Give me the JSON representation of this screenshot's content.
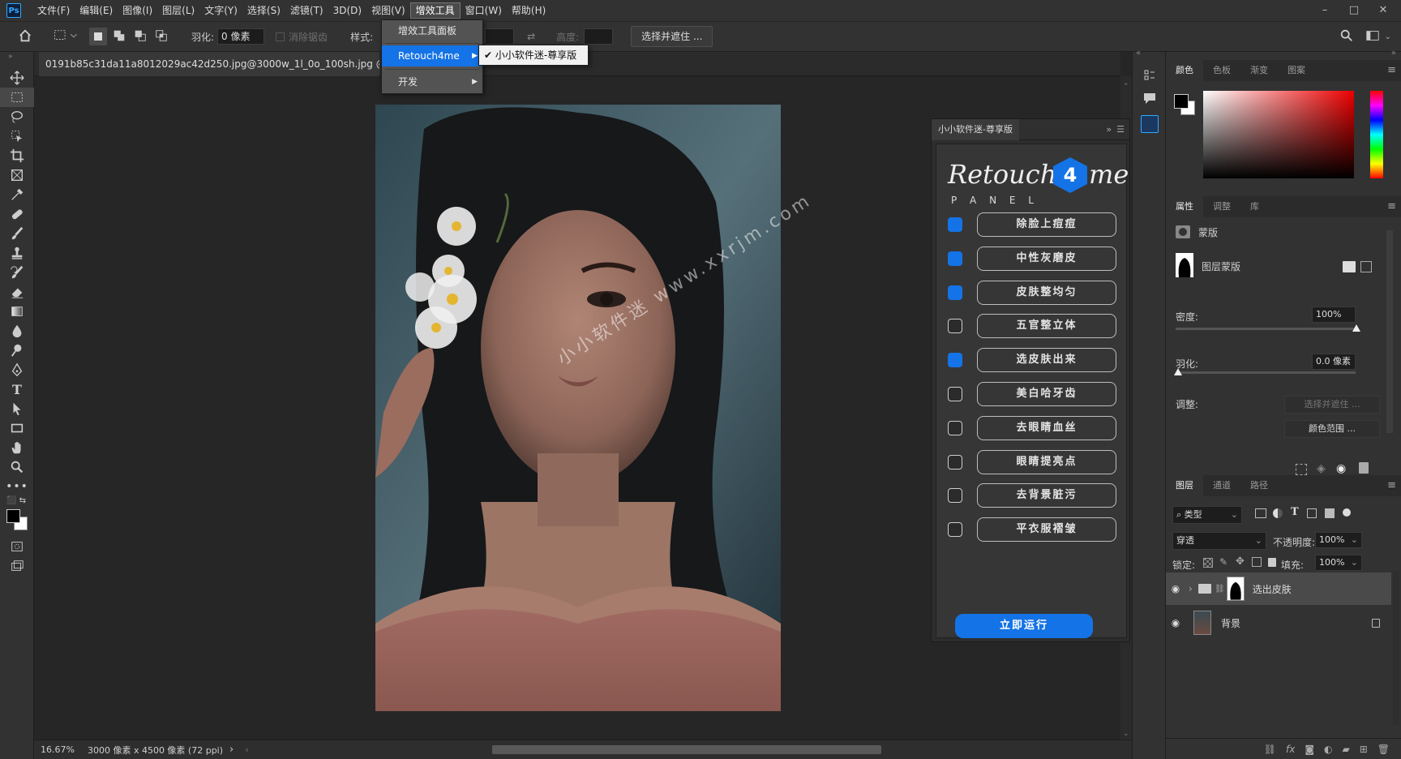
{
  "menubar": {
    "logo": "Ps",
    "items": [
      "文件(F)",
      "编辑(E)",
      "图像(I)",
      "图层(L)",
      "文字(Y)",
      "选择(S)",
      "滤镜(T)",
      "3D(D)",
      "视图(V)",
      "增效工具",
      "窗口(W)",
      "帮助(H)"
    ],
    "active_index": 9,
    "window_controls": [
      "–",
      "□",
      "✕"
    ]
  },
  "options": {
    "feather_label": "羽化:",
    "feather_value": "0 像素",
    "antialias_label": "消除锯齿",
    "style_label": "样式:",
    "height_label": "高度:",
    "select_mask_button": "选择并遮住 ..."
  },
  "dropdown": {
    "items": [
      {
        "label": "增效工具面板",
        "submenu": false
      },
      {
        "label": "Retouch4me",
        "submenu": true
      },
      {
        "label": "开发",
        "submenu": true
      }
    ],
    "selected_index": 1,
    "submenu_item": "✔ 小小软件迷-尊享版"
  },
  "document": {
    "tab_title": "0191b85c31da11a8012029ac42d250.jpg@3000w_1l_0o_100sh.jpg @ 16.7% (选"
  },
  "status": {
    "zoom": "16.67%",
    "doc_info": "3000 像素 x 4500 像素 (72 ppi)",
    "arrow": "›"
  },
  "watermark": "小小软件迷 www.xxrjm.com",
  "plugin": {
    "tab_title": "小小软件迷-尊享版",
    "logo_text_left": "Retouch",
    "logo_text_right": "me",
    "logo_mark": "4",
    "logo_sub": "P A N E L",
    "options": [
      {
        "label": "除脸上痘痘",
        "checked": true
      },
      {
        "label": "中性灰磨皮",
        "checked": true
      },
      {
        "label": "皮肤整均匀",
        "checked": true
      },
      {
        "label": "五官整立体",
        "checked": false
      },
      {
        "label": "选皮肤出来",
        "checked": true
      },
      {
        "label": "美白哈牙齿",
        "checked": false
      },
      {
        "label": "去眼睛血丝",
        "checked": false
      },
      {
        "label": "眼睛提亮点",
        "checked": false
      },
      {
        "label": "去背景脏污",
        "checked": false
      },
      {
        "label": "平衣服褶皱",
        "checked": false
      }
    ],
    "run_button": "立即运行",
    "accent": "#1473e6"
  },
  "color_panel": {
    "tabs": [
      "颜色",
      "色板",
      "渐变",
      "图案"
    ],
    "active_tab": 0
  },
  "properties_panel": {
    "tabs": [
      "属性",
      "调整",
      "库"
    ],
    "active_tab": 0,
    "mask_label": "蒙版",
    "layer_mask_label": "图层蒙版",
    "density_label": "密度:",
    "density_value": "100%",
    "feather_label": "羽化:",
    "feather_value": "0.0 像素",
    "adjust_label": "调整:",
    "select_mask_button": "选择并遮住 ...",
    "color_range_button": "颜色范围 ..."
  },
  "layers_panel": {
    "tabs": [
      "图层",
      "通道",
      "路径"
    ],
    "active_tab": 0,
    "filter_label": "类型",
    "blend_mode": "穿透",
    "opacity_label": "不透明度:",
    "opacity_value": "100%",
    "lock_label": "锁定:",
    "fill_label": "填充:",
    "fill_value": "100%",
    "layers": [
      {
        "name": "选出皮肤",
        "type": "group",
        "selected": true
      },
      {
        "name": "背景",
        "type": "image",
        "locked": true
      }
    ]
  }
}
